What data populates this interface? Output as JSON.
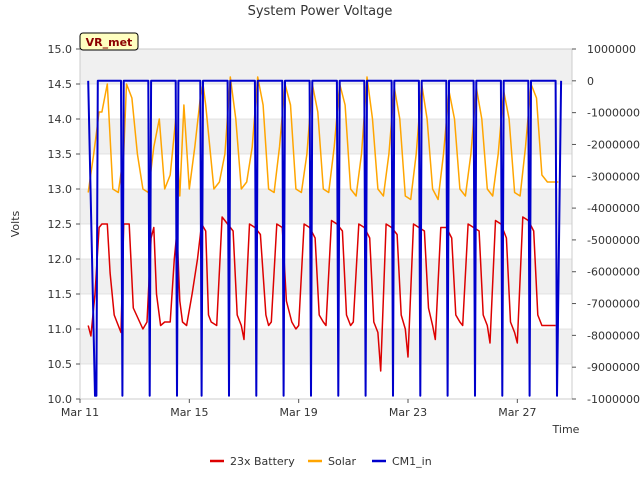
{
  "chart_data": {
    "type": "line",
    "title": "System Power Voltage",
    "xlabel": "Time",
    "ylabel": "Volts",
    "badge": "VR_met",
    "x_ticks": [
      "Mar 11",
      "Mar 15",
      "Mar 19",
      "Mar 23",
      "Mar 27"
    ],
    "x_tick_days": [
      11,
      15,
      19,
      23,
      27
    ],
    "xlim": [
      11,
      29
    ],
    "ylim": [
      10.0,
      15.0
    ],
    "y_ticks": [
      "10.0",
      "10.5",
      "11.0",
      "11.5",
      "12.0",
      "12.5",
      "13.0",
      "13.5",
      "14.0",
      "14.5",
      "15.0"
    ],
    "y2lim": [
      -10000000,
      1000000
    ],
    "y2_ticks": [
      "-10000000",
      "-9000000",
      "-8000000",
      "-7000000",
      "-6000000",
      "-5000000",
      "-4000000",
      "-3000000",
      "-2000000",
      "-1000000",
      "0",
      "1000000"
    ],
    "grid": "horizontal bands",
    "legend_position": "bottom",
    "series": [
      {
        "name": "23x Battery",
        "color": "#dd0000",
        "axis": "left",
        "x": [
          11.3,
          11.4,
          11.55,
          11.7,
          11.8,
          12.0,
          12.1,
          12.25,
          12.35,
          12.5,
          12.6,
          12.8,
          12.95,
          13.3,
          13.45,
          13.6,
          13.7,
          13.8,
          13.95,
          14.1,
          14.3,
          14.45,
          14.55,
          14.65,
          14.75,
          14.9,
          15.1,
          15.3,
          15.45,
          15.6,
          15.7,
          15.8,
          16.0,
          16.2,
          16.4,
          16.6,
          16.75,
          16.9,
          17.0,
          17.2,
          17.4,
          17.6,
          17.8,
          17.9,
          18.0,
          18.2,
          18.4,
          18.55,
          18.75,
          18.9,
          19.0,
          19.2,
          19.4,
          19.6,
          19.75,
          19.9,
          20.0,
          20.2,
          20.4,
          20.6,
          20.75,
          20.9,
          21.0,
          21.2,
          21.4,
          21.6,
          21.75,
          21.9,
          22.0,
          22.2,
          22.4,
          22.6,
          22.75,
          22.9,
          23.0,
          23.2,
          23.4,
          23.6,
          23.75,
          23.9,
          24.0,
          24.2,
          24.4,
          24.6,
          24.75,
          24.9,
          25.0,
          25.2,
          25.4,
          25.6,
          25.75,
          25.9,
          26.0,
          26.2,
          26.4,
          26.6,
          26.75,
          26.9,
          27.0,
          27.2,
          27.4,
          27.6,
          27.75,
          27.9,
          28.0,
          28.2,
          28.4
        ],
        "values": [
          11.05,
          10.9,
          11.5,
          12.45,
          12.5,
          12.5,
          11.8,
          11.2,
          11.1,
          10.95,
          12.5,
          12.5,
          11.3,
          11.0,
          11.1,
          12.3,
          12.45,
          11.5,
          11.05,
          11.1,
          11.1,
          12.0,
          12.4,
          11.4,
          11.1,
          11.05,
          11.5,
          12.0,
          12.5,
          12.4,
          11.2,
          11.1,
          11.05,
          12.6,
          12.5,
          12.4,
          11.2,
          11.05,
          10.85,
          12.5,
          12.45,
          12.35,
          11.2,
          11.05,
          11.1,
          12.5,
          12.45,
          11.4,
          11.1,
          11.0,
          11.05,
          12.5,
          12.45,
          12.3,
          11.2,
          11.1,
          11.05,
          12.55,
          12.5,
          12.4,
          11.2,
          11.05,
          11.1,
          12.5,
          12.45,
          12.3,
          11.1,
          10.95,
          10.4,
          12.5,
          12.45,
          12.35,
          11.2,
          11.0,
          10.6,
          12.5,
          12.45,
          12.4,
          11.3,
          11.05,
          10.85,
          12.45,
          12.45,
          12.3,
          11.2,
          11.1,
          11.05,
          12.5,
          12.45,
          12.4,
          11.2,
          11.05,
          10.8,
          12.55,
          12.5,
          12.3,
          11.1,
          10.95,
          10.8,
          12.6,
          12.55,
          12.4,
          11.2,
          11.05,
          11.05,
          11.05,
          11.05
        ]
      },
      {
        "name": "Solar",
        "color": "#ffa500",
        "axis": "left",
        "x": [
          11.3,
          11.5,
          11.7,
          11.8,
          12.0,
          12.2,
          12.4,
          12.6,
          12.7,
          12.9,
          13.1,
          13.3,
          13.5,
          13.7,
          13.9,
          14.1,
          14.3,
          14.5,
          14.65,
          14.8,
          15.0,
          15.2,
          15.4,
          15.5,
          15.6,
          15.75,
          15.9,
          16.1,
          16.3,
          16.5,
          16.7,
          16.9,
          17.1,
          17.3,
          17.5,
          17.7,
          17.9,
          18.1,
          18.3,
          18.5,
          18.7,
          18.9,
          19.1,
          19.3,
          19.5,
          19.7,
          19.9,
          20.1,
          20.3,
          20.5,
          20.7,
          20.9,
          21.1,
          21.3,
          21.5,
          21.7,
          21.9,
          22.1,
          22.3,
          22.5,
          22.7,
          22.9,
          23.1,
          23.3,
          23.5,
          23.7,
          23.9,
          24.1,
          24.3,
          24.5,
          24.7,
          24.9,
          25.1,
          25.3,
          25.5,
          25.7,
          25.9,
          26.1,
          26.3,
          26.5,
          26.7,
          26.9,
          27.1,
          27.3,
          27.5,
          27.7,
          27.9,
          28.1,
          28.3,
          28.5
        ],
        "values": [
          12.95,
          13.5,
          14.1,
          14.1,
          14.5,
          13.0,
          12.95,
          13.5,
          14.5,
          14.3,
          13.5,
          13.0,
          12.95,
          13.6,
          14.0,
          13.0,
          13.2,
          14.0,
          12.9,
          14.2,
          13.0,
          13.6,
          14.3,
          14.5,
          14.2,
          13.6,
          13.0,
          13.1,
          13.5,
          14.6,
          14.0,
          13.0,
          13.1,
          13.6,
          14.6,
          14.2,
          13.0,
          12.95,
          13.6,
          14.5,
          14.2,
          13.0,
          12.95,
          13.5,
          14.5,
          14.1,
          13.0,
          12.95,
          13.6,
          14.5,
          14.2,
          13.0,
          12.9,
          13.5,
          14.6,
          14.0,
          13.0,
          12.9,
          13.5,
          14.45,
          14.0,
          12.9,
          12.85,
          13.5,
          14.5,
          14.0,
          13.0,
          12.85,
          13.5,
          14.4,
          14.0,
          13.0,
          12.9,
          13.5,
          14.45,
          14.0,
          13.0,
          12.9,
          13.5,
          14.4,
          14.0,
          12.95,
          12.9,
          13.6,
          14.5,
          14.3,
          13.2,
          13.1,
          13.1,
          13.1
        ]
      },
      {
        "name": "CM1_in",
        "color": "#0000cc",
        "axis": "right",
        "x": [
          11.3,
          11.55,
          11.6,
          11.65,
          12.5,
          12.55,
          12.6,
          13.5,
          13.55,
          13.6,
          14.5,
          14.55,
          14.6,
          15.4,
          15.45,
          15.5,
          16.4,
          16.45,
          16.5,
          17.4,
          17.45,
          17.5,
          18.4,
          18.45,
          18.5,
          19.4,
          19.45,
          19.5,
          20.4,
          20.45,
          20.5,
          21.4,
          21.45,
          21.5,
          22.4,
          22.45,
          22.5,
          23.4,
          23.45,
          23.5,
          24.4,
          24.45,
          24.5,
          25.4,
          25.45,
          25.5,
          26.4,
          26.45,
          26.5,
          27.4,
          27.45,
          27.5,
          28.4,
          28.45,
          28.6
        ],
        "values": [
          0,
          -9900000,
          -9900000,
          0,
          0,
          -9900000,
          0,
          0,
          -9900000,
          0,
          0,
          -9900000,
          0,
          0,
          -9900000,
          0,
          0,
          -9900000,
          0,
          0,
          -9900000,
          0,
          0,
          -9900000,
          0,
          0,
          -9900000,
          0,
          0,
          -9900000,
          0,
          0,
          -9900000,
          0,
          0,
          -9900000,
          0,
          0,
          -9900000,
          0,
          0,
          -9900000,
          0,
          0,
          -9900000,
          0,
          0,
          -9900000,
          0,
          0,
          -9900000,
          0,
          0,
          -9900000,
          0
        ]
      }
    ]
  }
}
